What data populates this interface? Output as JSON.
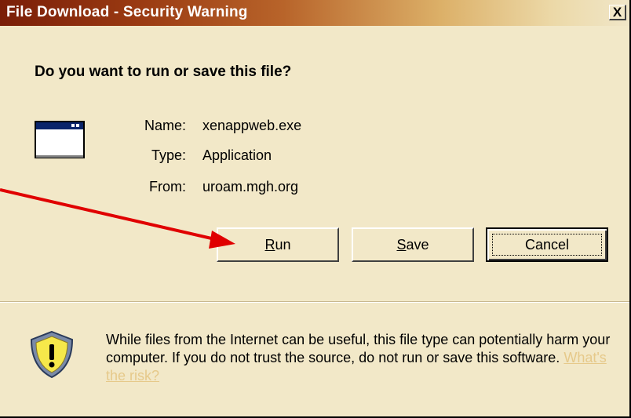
{
  "window": {
    "title": "File Download - Security Warning",
    "close_label": "X"
  },
  "prompt": {
    "question": "Do you want to run or save this file?"
  },
  "file": {
    "icon": "application-window-icon",
    "name_label": "Name:",
    "name_value": "xenappweb.exe",
    "type_label": "Type:",
    "type_value": "Application",
    "from_label": "From:",
    "from_value": "uroam.mgh.org"
  },
  "buttons": {
    "run_mnemonic": "R",
    "run_rest": "un",
    "save_mnemonic": "S",
    "save_rest": "ave",
    "cancel_label": "Cancel"
  },
  "warning": {
    "icon": "warning-shield-icon",
    "text": "While files from the Internet can be useful, this file type can potentially harm your computer. If you do not trust the source, do not run or save this software.",
    "link_label": "What's the risk?"
  },
  "colors": {
    "dialog_bg": "#f2e8c8",
    "title_start": "#7a1e08",
    "annotation_arrow": "#e00000",
    "link": "#e6c98a"
  }
}
